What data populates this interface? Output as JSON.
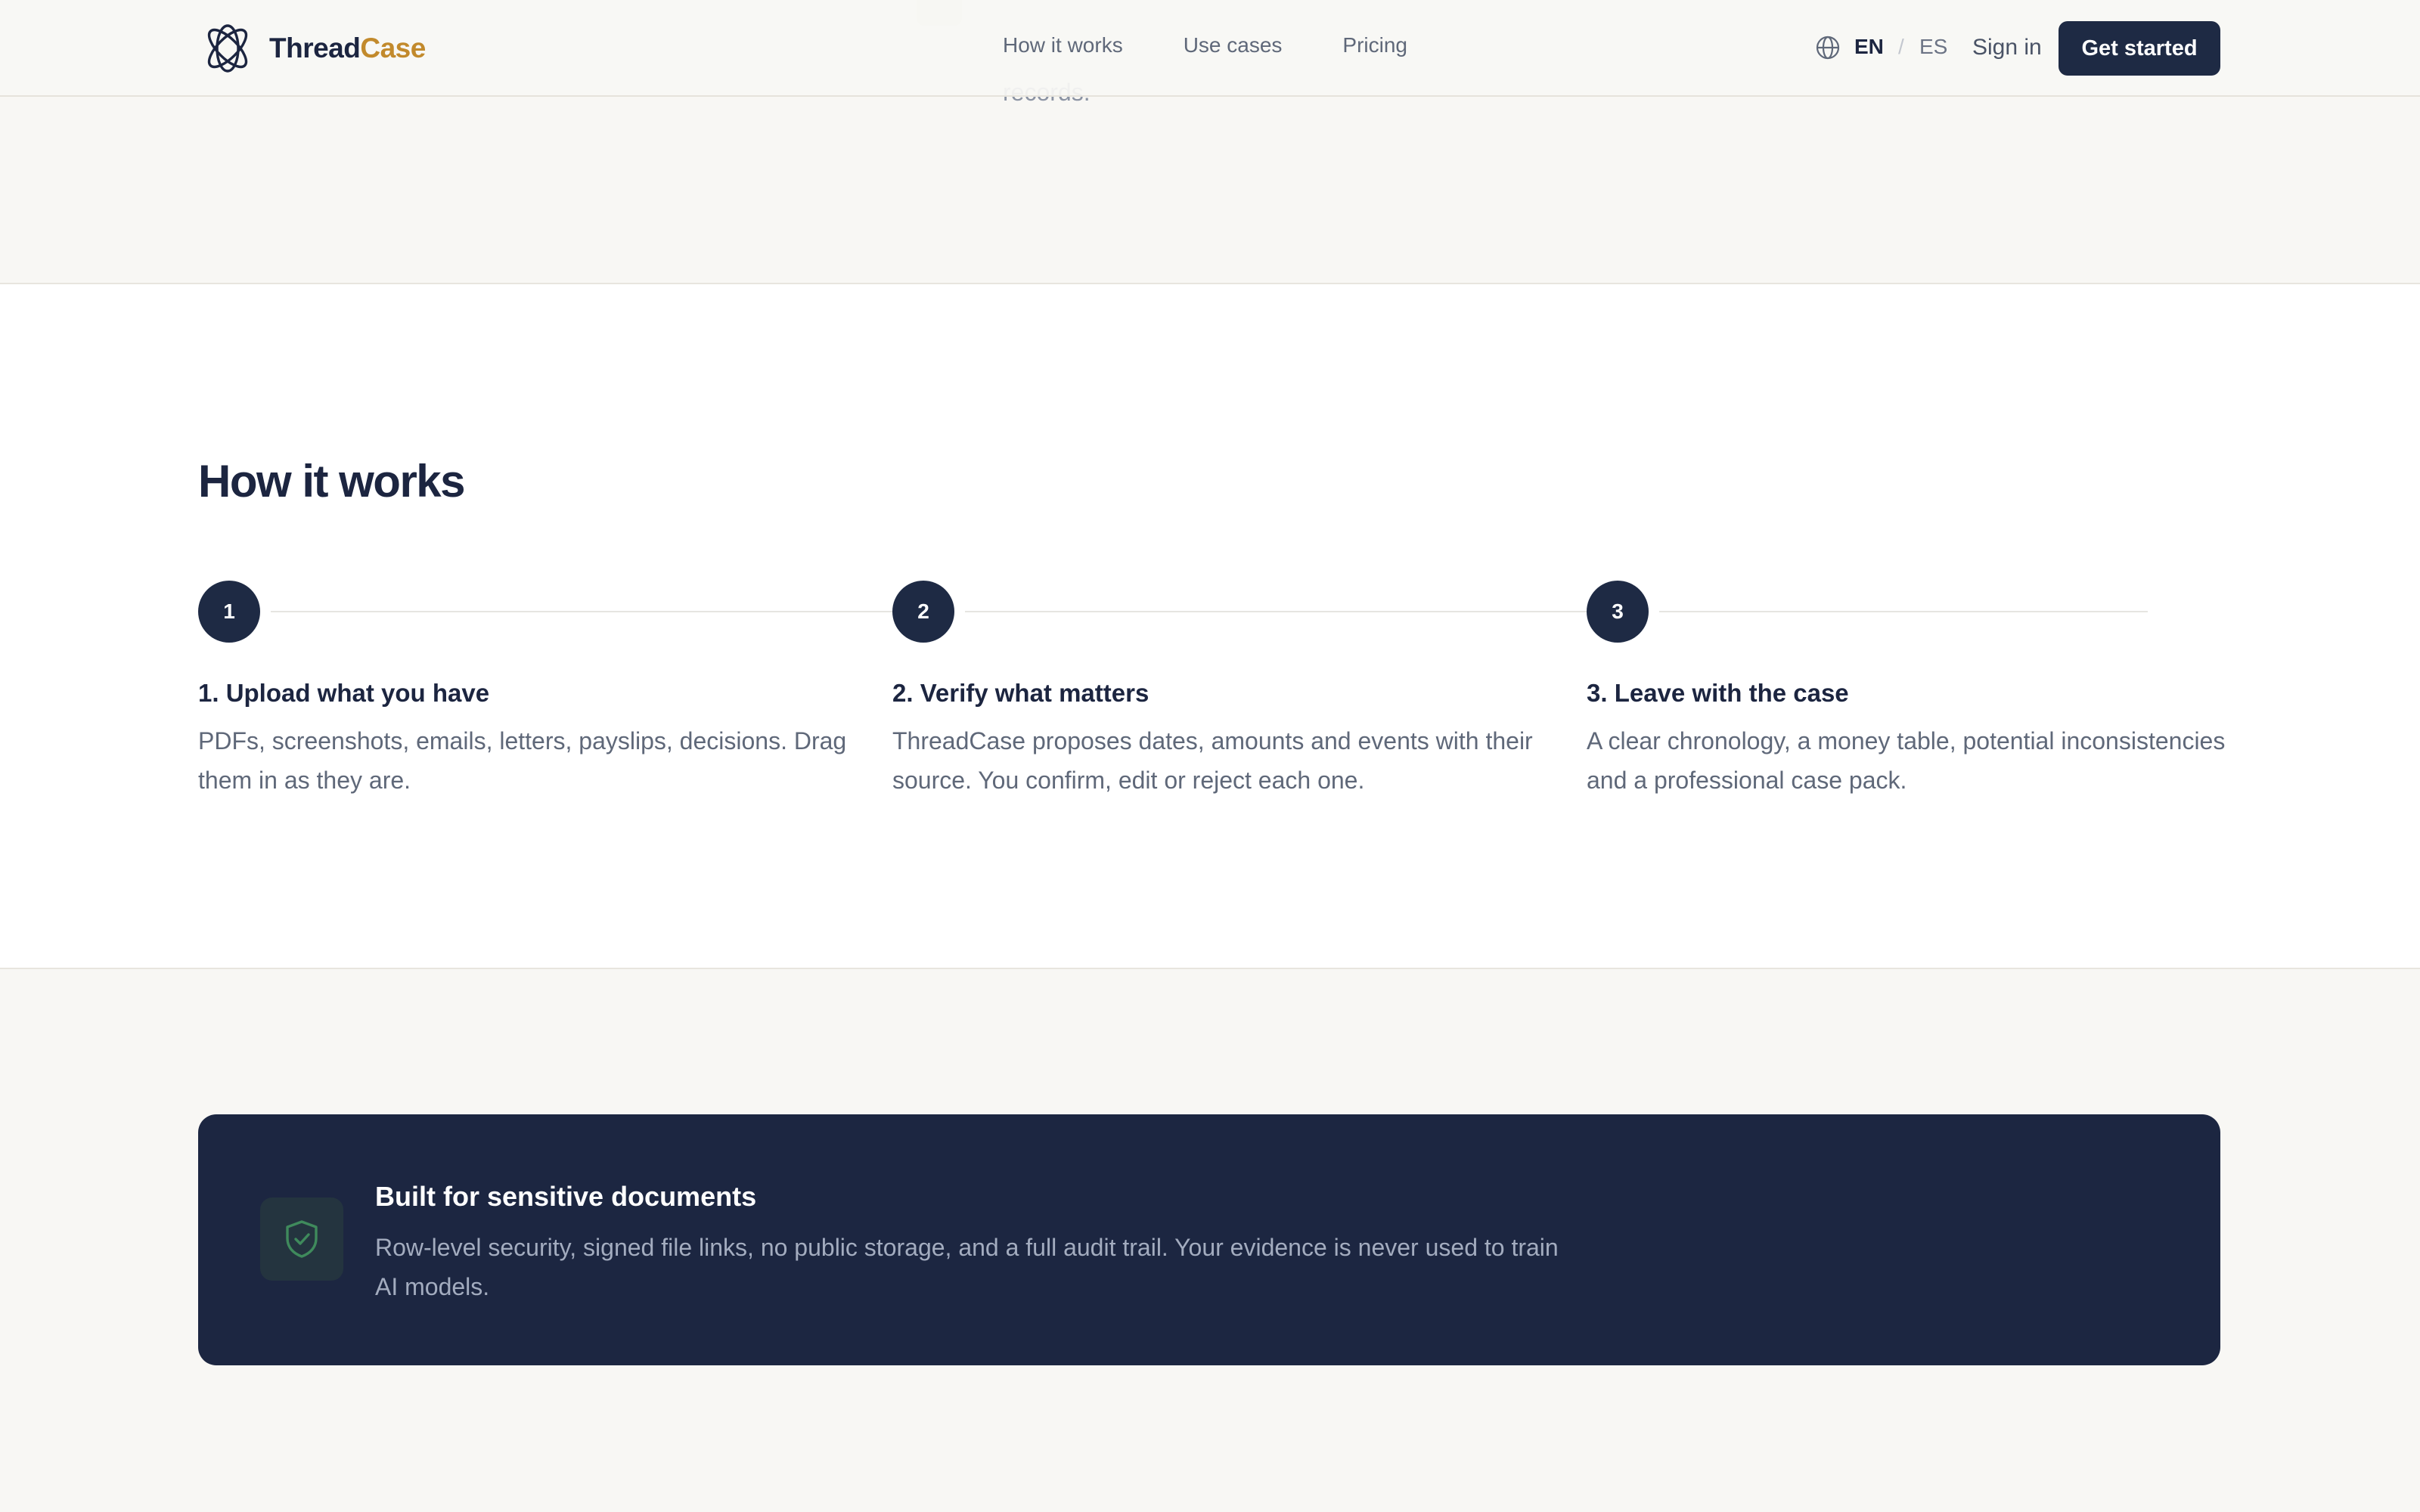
{
  "header": {
    "logo": {
      "part1": "Thread",
      "part2": "Case"
    },
    "nav": [
      {
        "label": "How it works"
      },
      {
        "label": "Use cases"
      },
      {
        "label": "Pricing"
      }
    ],
    "language": {
      "active": "EN",
      "separator": "/",
      "other": "ES"
    },
    "sign_in": "Sign in",
    "cta": "Get started"
  },
  "peek": {
    "line2": "records."
  },
  "how_it_works": {
    "title": "How it works",
    "steps": [
      {
        "number": "1",
        "title": "1. Upload what you have",
        "description": "PDFs, screenshots, emails, letters, payslips, decisions. Drag them in as they are."
      },
      {
        "number": "2",
        "title": "2. Verify what matters",
        "description": "ThreadCase proposes dates, amounts and events with their source. You confirm, edit or reject each one."
      },
      {
        "number": "3",
        "title": "3. Leave with the case",
        "description": "A clear chronology, a money table, potential inconsistencies and a professional case pack."
      }
    ]
  },
  "security_banner": {
    "icon": "shield-check-icon",
    "title": "Built for sensitive documents",
    "description": "Row-level security, signed file links, no public storage, and a full audit trail. Your evidence is never used to train AI models."
  },
  "colors": {
    "brand_navy": "#1e2a44",
    "brand_gold": "#c28a2c",
    "page_bg": "#f8f7f4",
    "shield_green": "#3f8a5c"
  }
}
